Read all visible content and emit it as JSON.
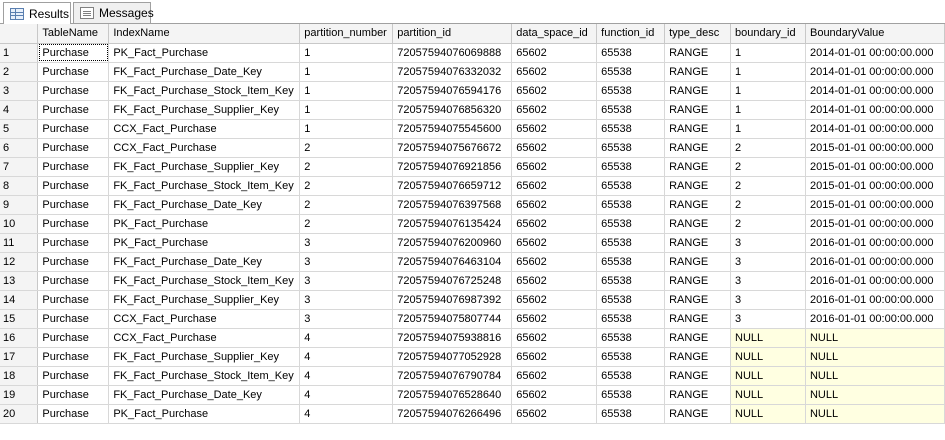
{
  "tabs": [
    {
      "label": "Results",
      "icon": "grid-icon",
      "active": true
    },
    {
      "label": "Messages",
      "icon": "messages-icon",
      "active": false
    }
  ],
  "columns": [
    "",
    "TableName",
    "IndexName",
    "partition_number",
    "partition_id",
    "data_space_id",
    "function_id",
    "type_desc",
    "boundary_id",
    "BoundaryValue"
  ],
  "rows": [
    [
      "1",
      "Purchase",
      "PK_Fact_Purchase",
      "1",
      "72057594076069888",
      "65602",
      "65538",
      "RANGE",
      "1",
      "2014-01-01 00:00:00.000"
    ],
    [
      "2",
      "Purchase",
      "FK_Fact_Purchase_Date_Key",
      "1",
      "72057594076332032",
      "65602",
      "65538",
      "RANGE",
      "1",
      "2014-01-01 00:00:00.000"
    ],
    [
      "3",
      "Purchase",
      "FK_Fact_Purchase_Stock_Item_Key",
      "1",
      "72057594076594176",
      "65602",
      "65538",
      "RANGE",
      "1",
      "2014-01-01 00:00:00.000"
    ],
    [
      "4",
      "Purchase",
      "FK_Fact_Purchase_Supplier_Key",
      "1",
      "72057594076856320",
      "65602",
      "65538",
      "RANGE",
      "1",
      "2014-01-01 00:00:00.000"
    ],
    [
      "5",
      "Purchase",
      "CCX_Fact_Purchase",
      "1",
      "72057594075545600",
      "65602",
      "65538",
      "RANGE",
      "1",
      "2014-01-01 00:00:00.000"
    ],
    [
      "6",
      "Purchase",
      "CCX_Fact_Purchase",
      "2",
      "72057594075676672",
      "65602",
      "65538",
      "RANGE",
      "2",
      "2015-01-01 00:00:00.000"
    ],
    [
      "7",
      "Purchase",
      "FK_Fact_Purchase_Supplier_Key",
      "2",
      "72057594076921856",
      "65602",
      "65538",
      "RANGE",
      "2",
      "2015-01-01 00:00:00.000"
    ],
    [
      "8",
      "Purchase",
      "FK_Fact_Purchase_Stock_Item_Key",
      "2",
      "72057594076659712",
      "65602",
      "65538",
      "RANGE",
      "2",
      "2015-01-01 00:00:00.000"
    ],
    [
      "9",
      "Purchase",
      "FK_Fact_Purchase_Date_Key",
      "2",
      "72057594076397568",
      "65602",
      "65538",
      "RANGE",
      "2",
      "2015-01-01 00:00:00.000"
    ],
    [
      "10",
      "Purchase",
      "PK_Fact_Purchase",
      "2",
      "72057594076135424",
      "65602",
      "65538",
      "RANGE",
      "2",
      "2015-01-01 00:00:00.000"
    ],
    [
      "11",
      "Purchase",
      "PK_Fact_Purchase",
      "3",
      "72057594076200960",
      "65602",
      "65538",
      "RANGE",
      "3",
      "2016-01-01 00:00:00.000"
    ],
    [
      "12",
      "Purchase",
      "FK_Fact_Purchase_Date_Key",
      "3",
      "72057594076463104",
      "65602",
      "65538",
      "RANGE",
      "3",
      "2016-01-01 00:00:00.000"
    ],
    [
      "13",
      "Purchase",
      "FK_Fact_Purchase_Stock_Item_Key",
      "3",
      "72057594076725248",
      "65602",
      "65538",
      "RANGE",
      "3",
      "2016-01-01 00:00:00.000"
    ],
    [
      "14",
      "Purchase",
      "FK_Fact_Purchase_Supplier_Key",
      "3",
      "72057594076987392",
      "65602",
      "65538",
      "RANGE",
      "3",
      "2016-01-01 00:00:00.000"
    ],
    [
      "15",
      "Purchase",
      "CCX_Fact_Purchase",
      "3",
      "72057594075807744",
      "65602",
      "65538",
      "RANGE",
      "3",
      "2016-01-01 00:00:00.000"
    ],
    [
      "16",
      "Purchase",
      "CCX_Fact_Purchase",
      "4",
      "72057594075938816",
      "65602",
      "65538",
      "RANGE",
      "NULL",
      "NULL"
    ],
    [
      "17",
      "Purchase",
      "FK_Fact_Purchase_Supplier_Key",
      "4",
      "72057594077052928",
      "65602",
      "65538",
      "RANGE",
      "NULL",
      "NULL"
    ],
    [
      "18",
      "Purchase",
      "FK_Fact_Purchase_Stock_Item_Key",
      "4",
      "72057594076790784",
      "65602",
      "65538",
      "RANGE",
      "NULL",
      "NULL"
    ],
    [
      "19",
      "Purchase",
      "FK_Fact_Purchase_Date_Key",
      "4",
      "72057594076528640",
      "65602",
      "65538",
      "RANGE",
      "NULL",
      "NULL"
    ],
    [
      "20",
      "Purchase",
      "PK_Fact_Purchase",
      "4",
      "72057594076266496",
      "65602",
      "65538",
      "RANGE",
      "NULL",
      "NULL"
    ]
  ],
  "colors": {
    "null_highlight": "#ffffe1",
    "header_bg": "#f4f4f4",
    "grid_line": "#d8d8d8"
  }
}
